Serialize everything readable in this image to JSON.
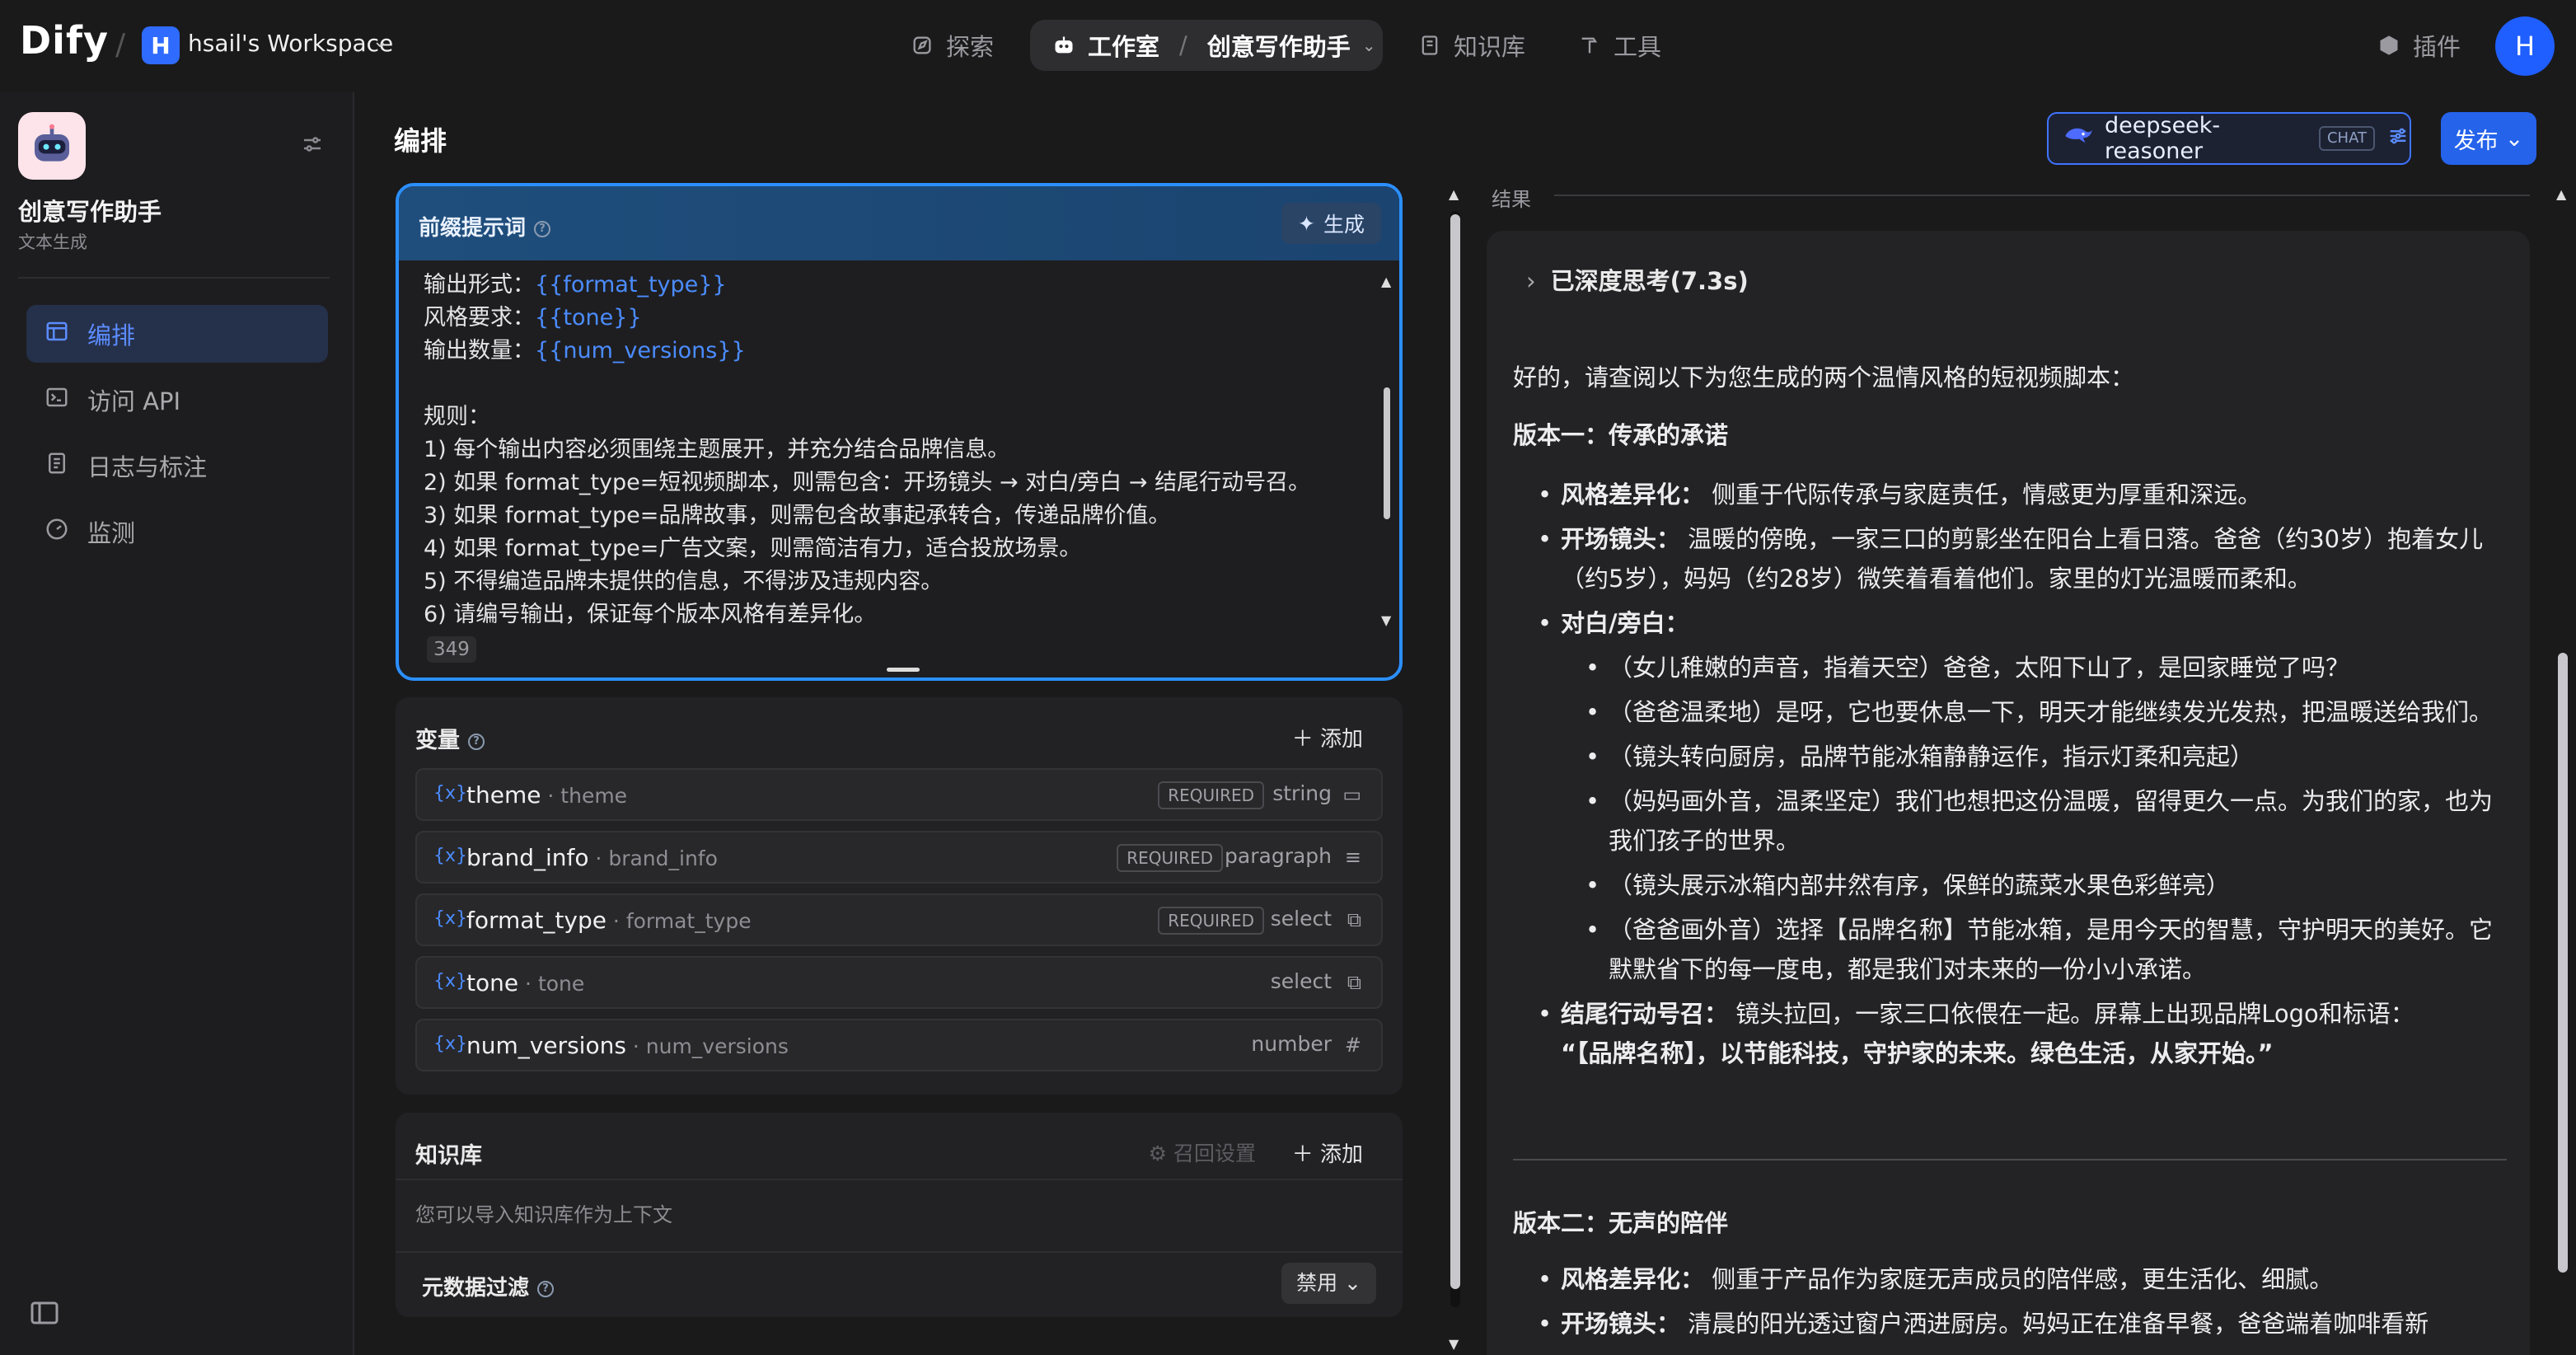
{
  "header": {
    "logo": "Dify",
    "workspace_initial": "H",
    "workspace_name": "hsail's Workspace",
    "nav": {
      "explore": "探索",
      "studio": "工作室",
      "current_app": "创意写作助手",
      "knowledge": "知识库",
      "tools": "工具",
      "plugins": "插件"
    },
    "user_initial": "H"
  },
  "sidebar": {
    "app_name": "创意写作助手",
    "app_type": "文本生成",
    "items": [
      {
        "label": "编排",
        "icon": "layout-icon",
        "active": true
      },
      {
        "label": "访问 API",
        "icon": "terminal-icon",
        "active": false
      },
      {
        "label": "日志与标注",
        "icon": "log-icon",
        "active": false
      },
      {
        "label": "监测",
        "icon": "monitor-icon",
        "active": false
      }
    ]
  },
  "editor": {
    "title": "编排",
    "prompt": {
      "label": "前缀提示词",
      "generate_label": "生成",
      "lines": [
        {
          "pre": "输出形式：",
          "var": "{{format_type}}"
        },
        {
          "pre": "风格要求：",
          "var": "{{tone}}"
        },
        {
          "pre": "输出数量：",
          "var": "{{num_versions}}"
        }
      ],
      "rules": [
        "规则：",
        "1) 每个输出内容必须围绕主题展开，并充分结合品牌信息。",
        "2) 如果 format_type=短视频脚本，则需包含：开场镜头 → 对白/旁白 → 结尾行动号召。",
        "3) 如果 format_type=品牌故事，则需包含故事起承转合，传递品牌价值。",
        "4) 如果 format_type=广告文案，则需简洁有力，适合投放场景。",
        "5) 不得编造品牌未提供的信息，不得涉及违规内容。",
        "6) 请编号输出，保证每个版本风格有差异化。"
      ],
      "char_count": "349"
    },
    "variables": {
      "title": "变量",
      "add_label": "添加",
      "required_label": "REQUIRED",
      "items": [
        {
          "name": "theme",
          "key": "theme",
          "required": true,
          "type": "string"
        },
        {
          "name": "brand_info",
          "key": "brand_info",
          "required": true,
          "type": "paragraph"
        },
        {
          "name": "format_type",
          "key": "format_type",
          "required": true,
          "type": "select"
        },
        {
          "name": "tone",
          "key": "tone",
          "required": false,
          "type": "select"
        },
        {
          "name": "num_versions",
          "key": "num_versions",
          "required": false,
          "type": "number"
        }
      ]
    },
    "knowledge": {
      "title": "知识库",
      "recall_label": "召回设置",
      "add_label": "添加",
      "empty_text": "您可以导入知识库作为上下文",
      "metadata_label": "元数据过滤",
      "metadata_value": "禁用"
    }
  },
  "model": {
    "name": "deepseek-reasoner",
    "mode_tag": "CHAT",
    "publish_label": "发布"
  },
  "result": {
    "label": "结果",
    "thinking": "已深度思考(7.3s)",
    "intro": "好的，请查阅以下为您生成的两个温情风格的短视频脚本：",
    "v1_title": "版本一：传承的承诺",
    "v1": {
      "style_label": "风格差异化：",
      "style": "侧重于代际传承与家庭责任，情感更为厚重和深远。",
      "open_label": "开场镜头：",
      "open": "温暖的傍晚，一家三口的剪影坐在阳台上看日落。爸爸（约30岁）抱着女儿（约5岁），妈妈（约28岁）微笑着看着他们。家里的灯光温暖而柔和。",
      "dialog_label": "对白/旁白：",
      "dialog": [
        "（女儿稚嫩的声音，指着天空）爸爸，太阳下山了，是回家睡觉了吗？",
        "（爸爸温柔地）是呀，它也要休息一下，明天才能继续发光发热，把温暖送给我们。",
        "（镜头转向厨房，品牌节能冰箱静静运作，指示灯柔和亮起）",
        "（妈妈画外音，温柔坚定）我们也想把这份温暖，留得更久一点。为我们的家，也为我们孩子的世界。",
        "（镜头展示冰箱内部井然有序，保鲜的蔬菜水果色彩鲜亮）",
        "（爸爸画外音）选择【品牌名称】节能冰箱，是用今天的智慧，守护明天的美好。它默默省下的每一度电，都是我们对未来的一份小小承诺。"
      ],
      "cta_label": "结尾行动号召：",
      "cta": "镜头拉回，一家三口依偎在一起。屏幕上出现品牌Logo和标语：",
      "slogan": "“【品牌名称】，以节能科技，守护家的未来。绿色生活，从家开始。”"
    },
    "v2_title": "版本二：无声的陪伴",
    "v2": {
      "style_label": "风格差异化：",
      "style": "侧重于产品作为家庭无声成员的陪伴感，更生活化、细腻。",
      "open_label": "开场镜头：",
      "open": "清晨的阳光透过窗户洒进厨房。妈妈正在准备早餐，爸爸端着咖啡看新"
    }
  }
}
